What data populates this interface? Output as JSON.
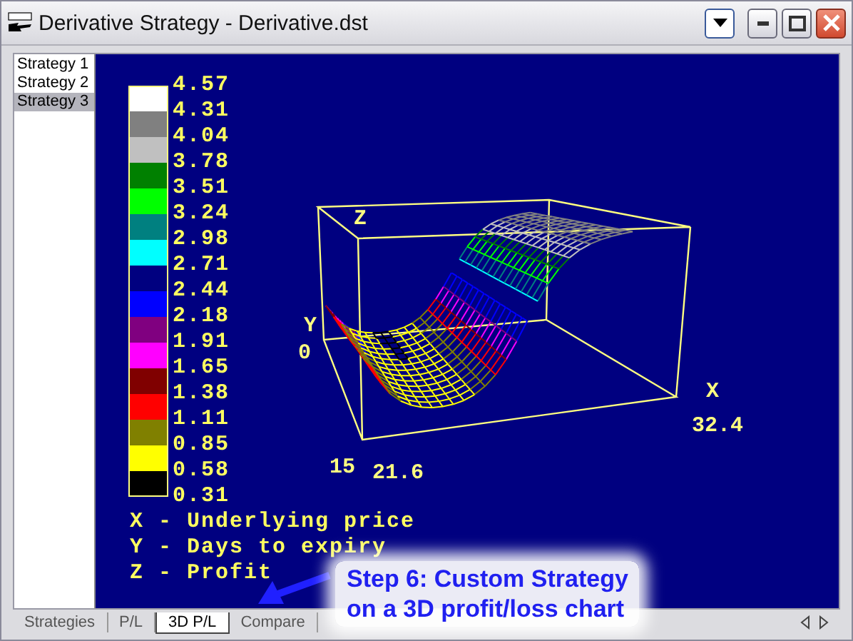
{
  "window": {
    "title": "Derivative Strategy - Derivative.dst"
  },
  "sidebar": {
    "items": [
      {
        "label": "Strategy 1",
        "selected": false
      },
      {
        "label": "Strategy 2",
        "selected": false
      },
      {
        "label": "Strategy 3",
        "selected": true
      }
    ]
  },
  "plot": {
    "legend": {
      "swatches": [
        {
          "color": "#ffffff"
        },
        {
          "color": "#808080"
        },
        {
          "color": "#c0c0c0"
        },
        {
          "color": "#008000"
        },
        {
          "color": "#00ff00"
        },
        {
          "color": "#008080"
        },
        {
          "color": "#00ffff"
        },
        {
          "color": "#000080"
        },
        {
          "color": "#0000ff"
        },
        {
          "color": "#800080"
        },
        {
          "color": "#ff00ff"
        },
        {
          "color": "#800000"
        },
        {
          "color": "#ff0000"
        },
        {
          "color": "#808000"
        },
        {
          "color": "#ffff00"
        },
        {
          "color": "#000000"
        }
      ],
      "labels": [
        "4.57",
        "4.31",
        "4.04",
        "3.78",
        "3.51",
        "3.24",
        "2.98",
        "2.71",
        "2.44",
        "2.18",
        "1.91",
        "1.65",
        "1.38",
        "1.11",
        "0.85",
        "0.58",
        "0.31"
      ]
    },
    "axis_notes": [
      "X - Underlying price",
      "Y - Days to expiry",
      "Z - Profit"
    ],
    "axis_labels": {
      "z": "Z",
      "y": "Y",
      "y_start": "0",
      "x": "X",
      "x_end": "32.4",
      "y_end": "15",
      "x_start": "21.6"
    }
  },
  "tabs": [
    {
      "label": "Strategies",
      "selected": false
    },
    {
      "label": "P/L",
      "selected": false
    },
    {
      "label": "3D P/L",
      "selected": true
    },
    {
      "label": "Compare",
      "selected": false
    }
  ],
  "callout": {
    "lines": [
      "Step 6: Custom Strategy",
      "on a 3D profit/loss chart"
    ]
  }
}
